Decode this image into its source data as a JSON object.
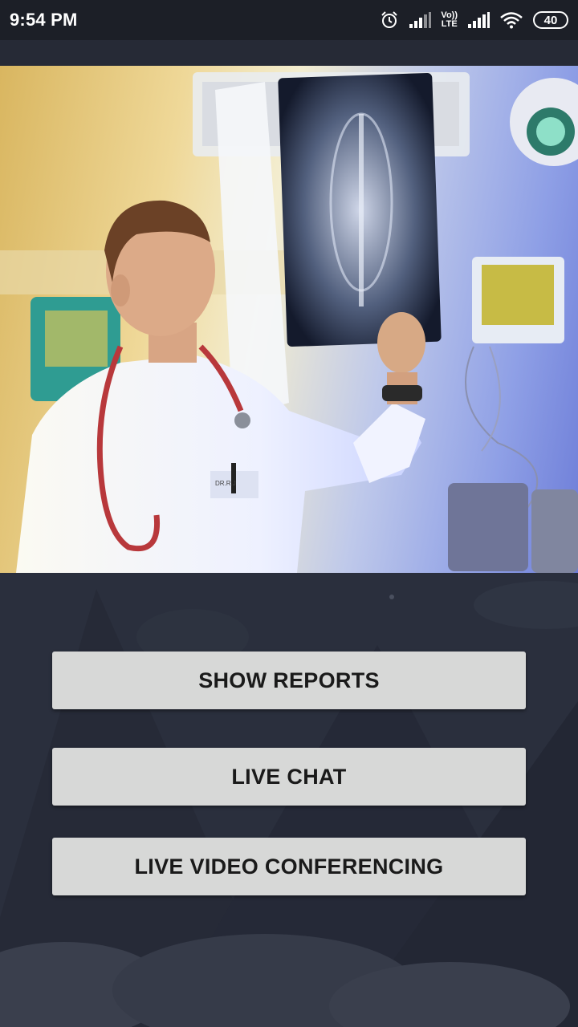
{
  "status_bar": {
    "time": "9:54 PM",
    "network_label_top": "Vo))",
    "network_label_bottom": "LTE",
    "battery_level": "40",
    "icons": [
      "alarm-icon",
      "signal-icon",
      "volte-icon",
      "signal-icon",
      "wifi-icon",
      "battery-icon"
    ]
  },
  "hero": {
    "badge_text": "DR.R.J"
  },
  "buttons": {
    "show_reports": "SHOW REPORTS",
    "live_chat": "LIVE CHAT",
    "live_video": "LIVE VIDEO CONFERENCING"
  },
  "colors": {
    "background": "#2a2f3d",
    "status_bar": "#1c1f27",
    "button": "#d7d8d7",
    "button_text": "#1a1a1a"
  }
}
